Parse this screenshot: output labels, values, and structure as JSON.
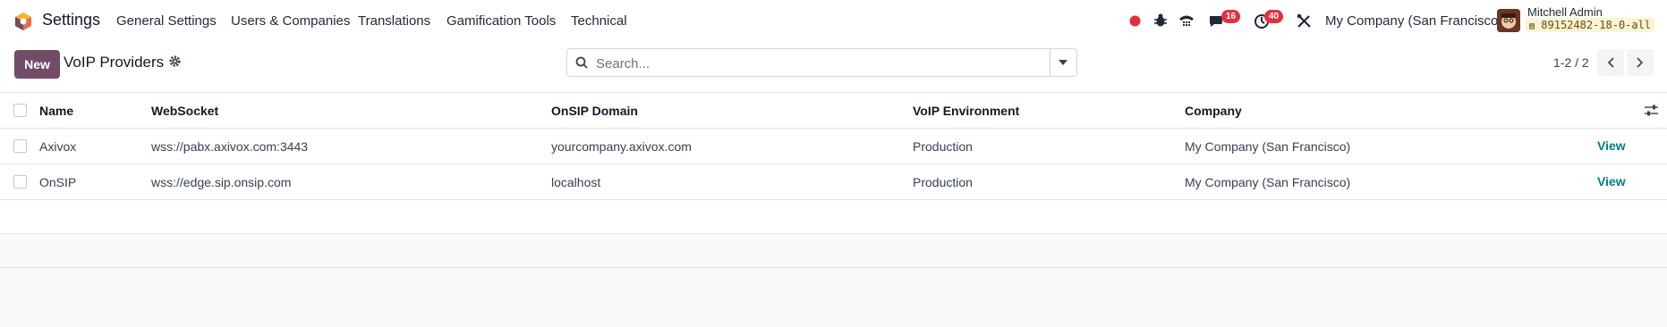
{
  "navbar": {
    "app_name": "Settings",
    "menu": [
      "General Settings",
      "Users & Companies",
      "Translations",
      "Gamification Tools",
      "Technical"
    ],
    "messages_count": "16",
    "activities_count": "40",
    "company": "My Company (San Francisco)",
    "user_name": "Mitchell Admin",
    "database": "89152482-18-0-all"
  },
  "control": {
    "new_label": "New",
    "breadcrumb": "VoIP Providers",
    "search_placeholder": "Search...",
    "pager": "1-2 / 2"
  },
  "table": {
    "columns": [
      "Name",
      "WebSocket",
      "OnSIP Domain",
      "VoIP Environment",
      "Company"
    ],
    "rows": [
      {
        "name": "Axivox",
        "websocket": "wss://pabx.axivox.com:3443",
        "domain": "yourcompany.axivox.com",
        "environment": "Production",
        "company": "My Company (San Francisco)",
        "action": "View"
      },
      {
        "name": "OnSIP",
        "websocket": "wss://edge.sip.onsip.com",
        "domain": "localhost",
        "environment": "Production",
        "company": "My Company (San Francisco)",
        "action": "View"
      }
    ]
  },
  "colors": {
    "brand": "#714b67",
    "link": "#017e84",
    "badge": "#e0313d",
    "recording": "#e0313d"
  }
}
